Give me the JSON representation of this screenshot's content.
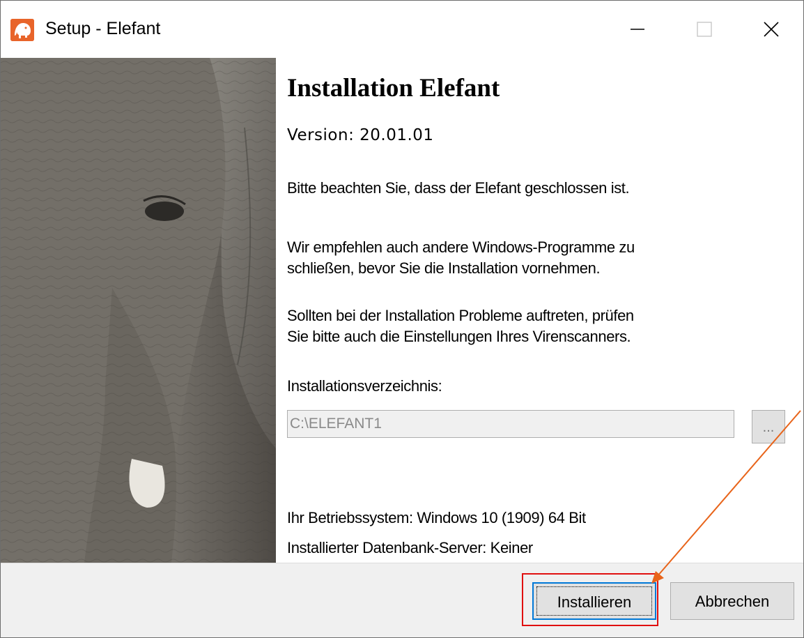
{
  "window": {
    "title": "Setup - Elefant"
  },
  "main": {
    "heading": "Installation Elefant",
    "version": "Version: 20.01.01",
    "note_closed": "Bitte beachten Sie, dass der Elefant geschlossen ist.",
    "recommend_line1": "Wir empfehlen auch andere Windows-Programme zu",
    "recommend_line2": "schließen, bevor Sie die Installation vornehmen.",
    "problems_line1": "Sollten bei der Installation Probleme auftreten, prüfen",
    "problems_line2": "Sie bitte auch die Einstellungen Ihres Virenscanners.",
    "dir_label": "Installationsverzeichnis:",
    "dir_value": "C:\\ELEFANT1",
    "browse_label": "...",
    "os_info": "Ihr Betriebssystem: Windows 10 (1909) 64 Bit",
    "db_info": "Installierter Datenbank-Server: Keiner"
  },
  "footer": {
    "install_label": "Installieren",
    "cancel_label": "Abbrechen"
  },
  "colors": {
    "annotation_box": "#e01010",
    "annotation_arrow": "#e8641a",
    "app_icon": "#e8642a"
  },
  "icons": [
    "elephant-app-icon",
    "minimize-icon",
    "maximize-icon",
    "close-icon"
  ]
}
